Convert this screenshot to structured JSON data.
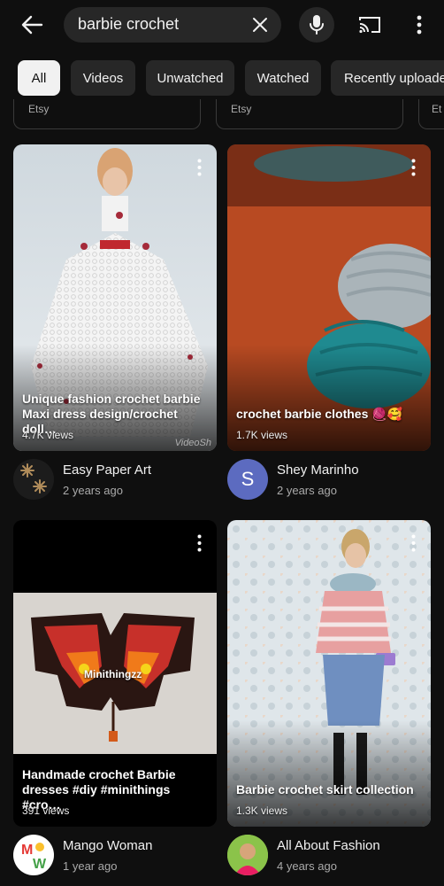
{
  "search": {
    "query": "barbie crochet"
  },
  "icons": {
    "back": "back-arrow-icon",
    "clear": "close-icon",
    "mic": "microphone-icon",
    "cast": "cast-icon",
    "more": "more-vert-icon"
  },
  "chips": [
    {
      "label": "All",
      "active": true
    },
    {
      "label": "Videos",
      "active": false
    },
    {
      "label": "Unwatched",
      "active": false
    },
    {
      "label": "Watched",
      "active": false
    },
    {
      "label": "Recently uploaded",
      "active": false
    }
  ],
  "partial_cards": [
    {
      "source": "Etsy"
    },
    {
      "source": "Etsy"
    },
    {
      "source": "Et"
    }
  ],
  "videos": [
    {
      "title": "Unique fashion crochet barbie Maxi dress design/crochet doll…",
      "views": "4.7K views",
      "watermark": "VideoSh",
      "channel": "Easy Paper Art",
      "age": "2 years ago"
    },
    {
      "title": "crochet barbie clothes 🧶🥰",
      "views": "1.7K views",
      "channel": "Shey Marinho",
      "age": "2 years ago",
      "avatar_letter": "S"
    },
    {
      "title": "Handmade crochet Barbie dresses #diy #minithings #cro…",
      "views": "391 views",
      "overlay_text": "Minithingzz",
      "channel": "Mango Woman",
      "age": "1 year ago"
    },
    {
      "title": "Barbie crochet skirt collection",
      "views": "1.3K views",
      "channel": "All About Fashion",
      "age": "4 years ago"
    }
  ],
  "colors": {
    "background": "#0f0f0f",
    "chip": "#272727",
    "chip_active": "#f1f1f1",
    "avatar_s": "#5c6bc0"
  }
}
